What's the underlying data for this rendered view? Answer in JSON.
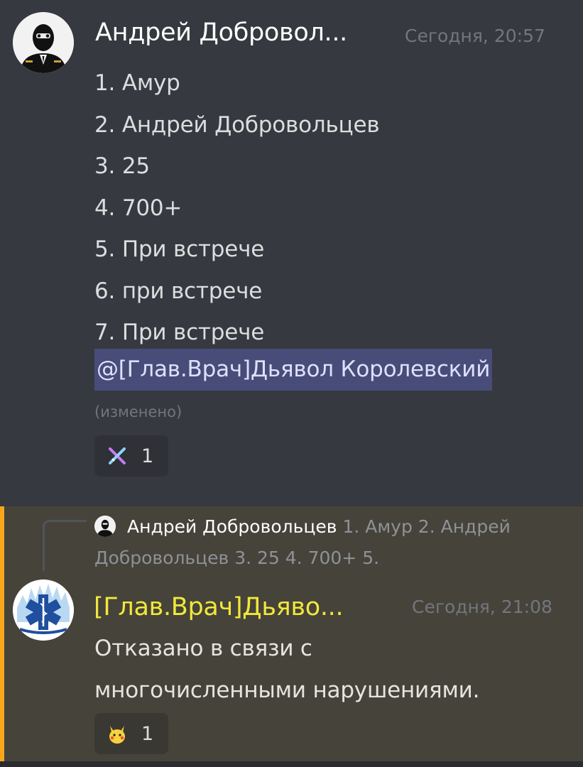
{
  "message1": {
    "author": "Андрей Добровол...",
    "timestamp": "Сегодня, 20:57",
    "lines": [
      "1. Амур",
      "2. Андрей Добровольцев",
      "3. 25",
      "4. 700+",
      "5. При встрече",
      "6. при встрече",
      "7. При встрече"
    ],
    "mention": "@[Глав.Врач]Дьявол Королевский",
    "edited": "(изменено)",
    "reaction": {
      "emoji": "crossed-swords-emoji",
      "count": "1"
    }
  },
  "message2": {
    "reply": {
      "author": "Андрей Добровольцев",
      "preview": "1. Амур 2. Андрей Добровольцев 3. 25 4. 700+ 5."
    },
    "author": "[Глав.Врач]Дьяво...",
    "timestamp": "Сегодня, 21:08",
    "lines": [
      "Отказано в связи с",
      "многочисленными нарушениями."
    ],
    "reaction": {
      "emoji": "pikachu-emoji",
      "count": "1"
    }
  },
  "colors": {
    "background": "#36393f",
    "highlight_background": "#46433a",
    "highlight_bar": "#faa61a",
    "doctor_role": "#f1e83a",
    "mention_bg": "#474d78"
  }
}
